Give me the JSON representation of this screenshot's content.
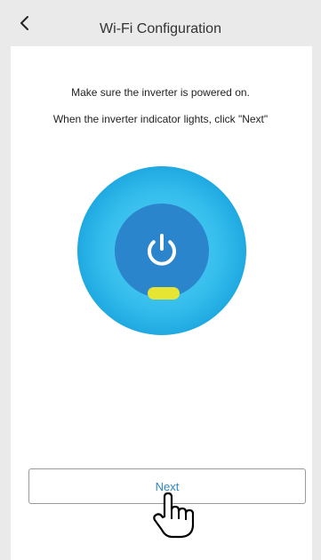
{
  "header": {
    "title": "Wi-Fi Configuration",
    "back_icon": "chevron-left-icon"
  },
  "instructions": {
    "line1": "Make sure the inverter is powered on.",
    "line2": "When the inverter indicator lights, click \"Next\""
  },
  "illustration": {
    "icon": "power-icon",
    "indicator_color": "#e6e533",
    "outer_color": "#29b6ea",
    "inner_color": "#2a85cc"
  },
  "next_button": {
    "label": "Next"
  },
  "cursor": {
    "icon": "hand-pointer-icon"
  }
}
